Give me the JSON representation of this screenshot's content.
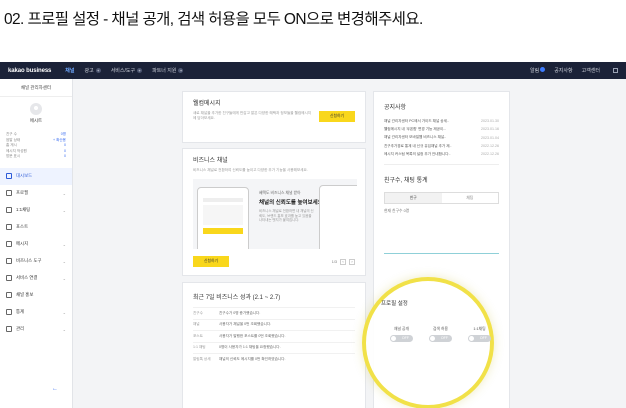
{
  "instruction": "02. 프로필 설정 - 채널 공개, 검색 허용을 모두 ON으로 변경해주세요.",
  "topnav": {
    "brand": "kakao business",
    "items": [
      "채널",
      "광고",
      "서비스/도구",
      "파트너 지원"
    ],
    "right": [
      "알림",
      "공지사항",
      "고객센터"
    ]
  },
  "sidebar": {
    "title": "채널 관리자센터",
    "profile_name": "에시트",
    "stats": [
      {
        "label": "친구 수",
        "value": "0명"
      },
      {
        "label": "쌈알 상태",
        "value": "+ 확산용"
      },
      {
        "label": "홈 게시",
        "value": "0"
      },
      {
        "label": "메시지 작성원",
        "value": "0"
      },
      {
        "label": "방문 표시",
        "value": "0"
      }
    ],
    "menu": [
      "대시보드",
      "프로필",
      "1:1채팅",
      "포스트",
      "메시지",
      "비즈니스 도구",
      "서비스 연결",
      "채널 홍보",
      "통계",
      "관리"
    ]
  },
  "welcome": {
    "title": "웰컴메시지",
    "text": "새로 채널을 추가한 친구들에게 반갑고 알은 다양한 혜택과 정보들을 웰컴메시지에 담아보세요.",
    "button": "신청하기"
  },
  "biz_channel": {
    "title": "비즈니스 채널",
    "text": "비즈니스 채널로 전환하여 신뢰도를 높이고 다양한 추가 기능을 사용해보세요.",
    "promo_small": "혜택도 비즈니스 채널 받아",
    "promo_big": "채널의 신뢰도를 높여보세요!",
    "promo_desc": "비즈니스 채널로 전환하면 내 채널의 신뢰도, 브랜드 홍보 효과를 높고 있음을 나타내는 뱃지가 붙여집니다.",
    "button": "신청하기",
    "pager": "1/3"
  },
  "performance": {
    "title": "최근 7일 비즈니스 성과 (2.1 ~ 2.7)",
    "rows": [
      {
        "label": "친구수",
        "value": "친구수가 0명 증가했습니다."
      },
      {
        "label": "채널",
        "value": "사용자가 채널을 0번 조회했습니다."
      },
      {
        "label": "포스트",
        "value": "사용자가 발행한 포스트를 0번 조회했습니다."
      },
      {
        "label": "1:1 채팅",
        "value": "0명이 사용자가 1:1 채팅을 요청했습니다."
      },
      {
        "label": "알림톡 상세",
        "value": "채널의 신뢰도 메시지를 0번 확인하였습니다."
      }
    ]
  },
  "notices": {
    "title": "공지사항",
    "items": [
      {
        "text": "채널 관리자센터 PC에서 가이드 채널 상세..",
        "date": "2023.01.30"
      },
      {
        "text": "웰컴메시지 내 '쿠폰함' 변경 기능 제공이...",
        "date": "2023.01.16"
      },
      {
        "text": "채널 관리자센터 모바일웹 비즈니스 채널..",
        "date": "2023.01.04"
      },
      {
        "text": "친구추가경로 통계 내 신규 유입채널 추가 제..",
        "date": "2022.12.26"
      },
      {
        "text": "메시지 커스텀 목록의 설정 추가 안내합니다..",
        "date": "2022.12.26"
      }
    ]
  },
  "friend_stats": {
    "title": "친구수, 채팅 통계",
    "tabs": [
      "친구",
      "채팅"
    ],
    "sub": "현재 친구수 0명"
  },
  "profile_settings": {
    "title": "프로필 설정",
    "toggles": [
      {
        "label": "채널 공개",
        "state": "OFF"
      },
      {
        "label": "검색 허용",
        "state": "OFF"
      },
      {
        "label": "1:1채팅",
        "state": "OFF"
      }
    ]
  },
  "colors": {
    "accent": "#f9d71c",
    "nav": "#1b2238",
    "link": "#3a6df0",
    "highlight_ring": "#f1e148"
  }
}
